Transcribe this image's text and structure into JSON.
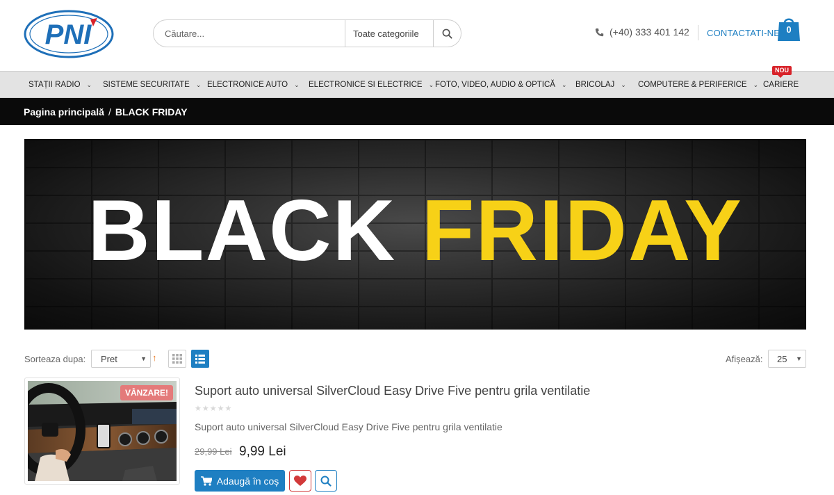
{
  "header": {
    "logo_text": "PNI",
    "search": {
      "placeholder": "Căutare...",
      "category": "Toate categoriile"
    },
    "phone": "(+40) 333 401 142",
    "contact_label": "CONTACTATI-NE",
    "cart_count": "0"
  },
  "nav": {
    "items": [
      {
        "label": "STAȚII RADIO"
      },
      {
        "label": "SISTEME SECURITATE"
      },
      {
        "label": "ELECTRONICE AUTO"
      },
      {
        "label": "ELECTRONICE SI ELECTRICE"
      },
      {
        "label": "FOTO, VIDEO, AUDIO & OPTICĂ"
      },
      {
        "label": "BRICOLAJ"
      },
      {
        "label": "COMPUTERE & PERIFERICE"
      },
      {
        "label": "CARIERE"
      }
    ],
    "new_badge": "NOU"
  },
  "breadcrumb": {
    "home": "Pagina principală",
    "separator": "/",
    "current": "BLACK FRIDAY"
  },
  "banner": {
    "word1": "BLACK",
    "word2": "FRIDAY"
  },
  "toolbar": {
    "sort_label": "Sorteaza dupa:",
    "sort_value": "Pret",
    "sort_direction": "↑",
    "show_label": "Afișează:",
    "show_value": "25"
  },
  "product": {
    "badge": "VÂNZARE!",
    "title": "Suport auto universal SilverCloud Easy Drive Five pentru grila ventilatie",
    "rating": 0,
    "description": "Suport auto universal SilverCloud Easy Drive Five pentru grila ventilatie",
    "old_price": "29,99 Lei",
    "new_price": "9,99 Lei",
    "add_to_cart_label": "Adaugă în coș"
  },
  "colors": {
    "accent": "#1e7fc2",
    "banner_highlight": "#f7d117",
    "sale_badge": "#e47a7a",
    "new_badge": "#d8232a"
  }
}
